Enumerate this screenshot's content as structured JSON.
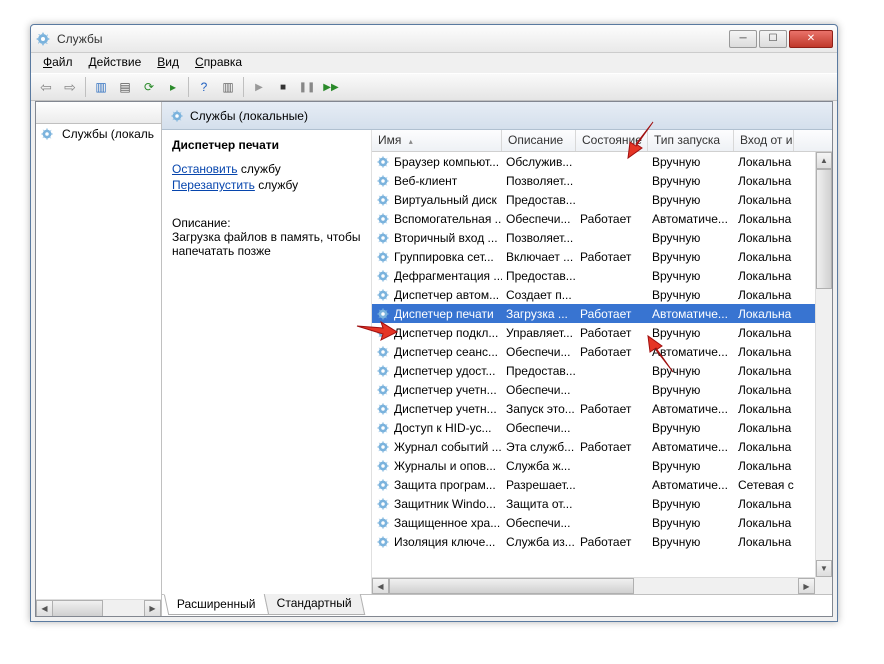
{
  "window": {
    "title": "Службы"
  },
  "menu": {
    "file": "Файл",
    "action": "Действие",
    "view": "Вид",
    "help": "Справка"
  },
  "tree": {
    "root": "Службы (локаль"
  },
  "header": {
    "title": "Службы (локальные)"
  },
  "detail": {
    "title": "Диспетчер печати",
    "stop_pre": "Остановить",
    "stop_post": " службу",
    "restart_pre": "Перезапустить",
    "restart_post": " службу",
    "desc_label": "Описание:",
    "desc_text": "Загрузка файлов в память, чтобы напечатать позже"
  },
  "columns": {
    "name": "Имя",
    "desc": "Описание",
    "status": "Состояние",
    "startup": "Тип запуска",
    "logon": "Вход от и"
  },
  "rows": [
    {
      "name": "Браузер компьют...",
      "desc": "Обслужив...",
      "status": "",
      "startup": "Вручную",
      "logon": "Локальна"
    },
    {
      "name": "Веб-клиент",
      "desc": "Позволяет...",
      "status": "",
      "startup": "Вручную",
      "logon": "Локальна"
    },
    {
      "name": "Виртуальный диск",
      "desc": "Предостав...",
      "status": "",
      "startup": "Вручную",
      "logon": "Локальна"
    },
    {
      "name": "Вспомогательная ...",
      "desc": "Обеспечи...",
      "status": "Работает",
      "startup": "Автоматиче...",
      "logon": "Локальна"
    },
    {
      "name": "Вторичный вход ...",
      "desc": "Позволяет...",
      "status": "",
      "startup": "Вручную",
      "logon": "Локальна"
    },
    {
      "name": "Группировка сет...",
      "desc": "Включает ...",
      "status": "Работает",
      "startup": "Вручную",
      "logon": "Локальна"
    },
    {
      "name": "Дефрагментация ...",
      "desc": "Предостав...",
      "status": "",
      "startup": "Вручную",
      "logon": "Локальна"
    },
    {
      "name": "Диспетчер автом...",
      "desc": "Создает п...",
      "status": "",
      "startup": "Вручную",
      "logon": "Локальна"
    },
    {
      "name": "Диспетчер печати",
      "desc": "Загрузка ...",
      "status": "Работает",
      "startup": "Автоматиче...",
      "logon": "Локальна",
      "selected": true
    },
    {
      "name": "Диспетчер подкл...",
      "desc": "Управляет...",
      "status": "Работает",
      "startup": "Вручную",
      "logon": "Локальна"
    },
    {
      "name": "Диспетчер сеанс...",
      "desc": "Обеспечи...",
      "status": "Работает",
      "startup": "Автоматиче...",
      "logon": "Локальна"
    },
    {
      "name": "Диспетчер удост...",
      "desc": "Предостав...",
      "status": "",
      "startup": "Вручную",
      "logon": "Локальна"
    },
    {
      "name": "Диспетчер учетн...",
      "desc": "Обеспечи...",
      "status": "",
      "startup": "Вручную",
      "logon": "Локальна"
    },
    {
      "name": "Диспетчер учетн...",
      "desc": "Запуск это...",
      "status": "Работает",
      "startup": "Автоматиче...",
      "logon": "Локальна"
    },
    {
      "name": "Доступ к HID-ус...",
      "desc": "Обеспечи...",
      "status": "",
      "startup": "Вручную",
      "logon": "Локальна"
    },
    {
      "name": "Журнал событий ...",
      "desc": "Эта служб...",
      "status": "Работает",
      "startup": "Автоматиче...",
      "logon": "Локальна"
    },
    {
      "name": "Журналы и опов...",
      "desc": "Служба ж...",
      "status": "",
      "startup": "Вручную",
      "logon": "Локальна"
    },
    {
      "name": "Защита програм...",
      "desc": "Разрешает...",
      "status": "",
      "startup": "Автоматиче...",
      "logon": "Сетевая с"
    },
    {
      "name": "Защитник Windo...",
      "desc": "Защита от...",
      "status": "",
      "startup": "Вручную",
      "logon": "Локальна"
    },
    {
      "name": "Защищенное хра...",
      "desc": "Обеспечи...",
      "status": "",
      "startup": "Вручную",
      "logon": "Локальна"
    },
    {
      "name": "Изоляция ключе...",
      "desc": "Служба из...",
      "status": "Работает",
      "startup": "Вручную",
      "logon": "Локальна"
    }
  ],
  "tabs": {
    "extended": "Расширенный",
    "standard": "Стандартный"
  }
}
